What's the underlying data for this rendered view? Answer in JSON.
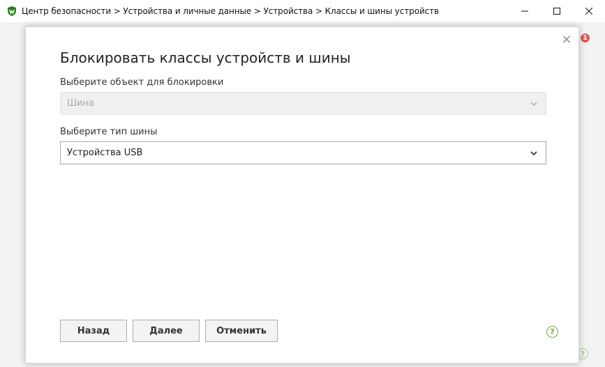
{
  "window": {
    "title": "Центр безопасности > Устройства и личные данные > Устройства > Классы и шины устройств",
    "controls": {
      "minimize": "—",
      "maximize": "☐",
      "close": "✕"
    }
  },
  "background": {
    "notification_count": "1",
    "help_label": "?"
  },
  "dialog": {
    "title": "Блокировать классы устройств и шины",
    "close_label": "×",
    "object_field": {
      "label": "Выберите объект для блокировки",
      "value": "Шина",
      "disabled": true
    },
    "bus_field": {
      "label": "Выберите тип шины",
      "value": "Устройства USB"
    },
    "buttons": {
      "back": "Назад",
      "next": "Далее",
      "cancel": "Отменить"
    },
    "help_label": "?"
  },
  "colors": {
    "accent_green": "#6bb338",
    "badge_red": "#e05a4f",
    "disabled_text": "#a8a8a8"
  }
}
